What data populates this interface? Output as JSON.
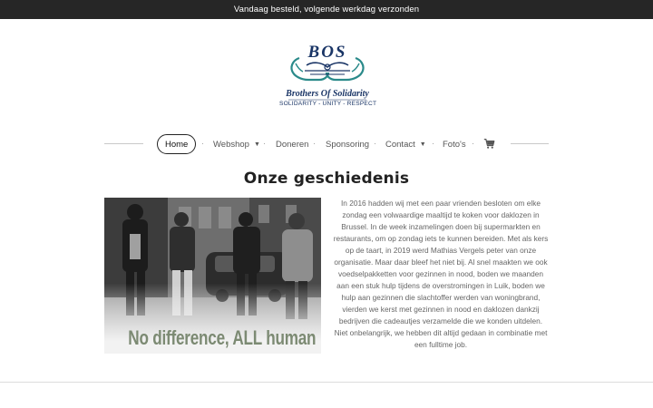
{
  "announcement": "Vandaag besteld, volgende werkdag verzonden",
  "logo": {
    "initials": "BOS",
    "name": "Brothers Of Solidarity",
    "tagline": "SOLIDARITY - UNITY - RESPECT"
  },
  "nav": {
    "home": "Home",
    "webshop": "Webshop",
    "doneren": "Doneren",
    "sponsoring": "Sponsoring",
    "contact": "Contact",
    "fotos": "Foto's",
    "separator": "·",
    "dropdown_caret": "▼",
    "cart_icon": "shopping-cart-icon"
  },
  "main": {
    "heading": "Onze geschiedenis",
    "photo_caption": "No difference, ALL human",
    "story": "In 2016 hadden wij met een paar vrienden besloten om elke zondag een volwaardige maaltijd te koken voor daklozen in Brussel. In de week inzamelingen doen bij supermarkten en restaurants, om op zondag iets te kunnen bereiden. Met als kers op de taart, in 2019 werd Mathias Vergels peter van onze organisatie. Maar daar bleef het niet bij. Al snel maakten we ook voedselpakketten voor gezinnen in nood, boden we maanden aan een stuk hulp tijdens de overstromingen in Luik, boden we hulp aan gezinnen die slachtoffer werden van woningbrand, vierden we kerst met gezinnen in nood en daklozen dankzij bedrijven die cadeautjes verzamelde die we konden uitdelen. Niet onbelangrijk, we hebben dit altijd gedaan in combinatie met een fulltime job."
  },
  "colors": {
    "topbar": "#262626",
    "logo_blue": "#1a3566",
    "logo_teal": "#2a8a8a",
    "caption_green": "#7c8a73"
  }
}
